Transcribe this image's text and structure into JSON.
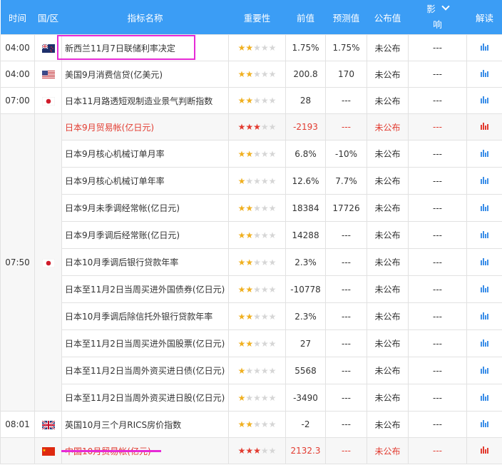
{
  "header": {
    "time": "时间",
    "country": "国/区",
    "indicator": "指标名称",
    "importance": "重要性",
    "previous": "前值",
    "forecast": "预测值",
    "actual": "公布值",
    "impact_top": "影",
    "impact_bottom": "响",
    "read": "解读"
  },
  "colors": {
    "header_bg": "#3b9df5",
    "highlight_red": "#e23b30",
    "annotation": "#e62ad6",
    "star": "#f0b020"
  },
  "rows": [
    {
      "time": "04:00",
      "flag": "nz",
      "indicator": "新西兰11月7日联储利率决定",
      "stars": 2,
      "previous": "1.75%",
      "forecast": "1.75%",
      "actual": "未公布",
      "impact": "---",
      "hi": false
    },
    {
      "time": "04:00",
      "flag": "us",
      "indicator": "美国9月消费信贷(亿美元)",
      "stars": 2,
      "previous": "200.8",
      "forecast": "170",
      "actual": "未公布",
      "impact": "---",
      "hi": false
    },
    {
      "time": "07:00",
      "flag": "jp",
      "indicator": "日本11月路透短观制造业景气判断指数",
      "stars": 2,
      "previous": "28",
      "forecast": "---",
      "actual": "未公布",
      "impact": "---",
      "hi": false
    },
    {
      "time": "",
      "flag": "",
      "indicator": "日本9月贸易帐(亿日元)",
      "stars": 3,
      "previous": "-2193",
      "forecast": "---",
      "actual": "未公布",
      "impact": "---",
      "hi": true
    },
    {
      "time": "",
      "flag": "",
      "indicator": "日本9月核心机械订单月率",
      "stars": 2,
      "previous": "6.8%",
      "forecast": "-10%",
      "actual": "未公布",
      "impact": "---",
      "hi": false
    },
    {
      "time": "",
      "flag": "",
      "indicator": "日本9月核心机械订单年率",
      "stars": 1,
      "previous": "12.6%",
      "forecast": "7.7%",
      "actual": "未公布",
      "impact": "---",
      "hi": false
    },
    {
      "time": "",
      "flag": "",
      "indicator": "日本9月未季调经常帐(亿日元)",
      "stars": 2,
      "previous": "18384",
      "forecast": "17726",
      "actual": "未公布",
      "impact": "---",
      "hi": false
    },
    {
      "time": "",
      "flag": "",
      "indicator": "日本9月季调后经常账(亿日元)",
      "stars": 2,
      "previous": "14288",
      "forecast": "---",
      "actual": "未公布",
      "impact": "---",
      "hi": false
    },
    {
      "time": "07:50",
      "flag": "jp",
      "indicator": "日本10月季调后银行贷款年率",
      "stars": 2,
      "previous": "2.3%",
      "forecast": "---",
      "actual": "未公布",
      "impact": "---",
      "hi": false
    },
    {
      "time": "",
      "flag": "",
      "indicator": "日本至11月2日当周买进外国债券(亿日元)",
      "stars": 2,
      "previous": "-10778",
      "forecast": "---",
      "actual": "未公布",
      "impact": "---",
      "hi": false
    },
    {
      "time": "",
      "flag": "",
      "indicator": "日本10月季调后除信托外银行贷款年率",
      "stars": 2,
      "previous": "2.3%",
      "forecast": "---",
      "actual": "未公布",
      "impact": "---",
      "hi": false
    },
    {
      "time": "",
      "flag": "",
      "indicator": "日本至11月2日当周买进外国股票(亿日元)",
      "stars": 2,
      "previous": "27",
      "forecast": "---",
      "actual": "未公布",
      "impact": "---",
      "hi": false
    },
    {
      "time": "",
      "flag": "",
      "indicator": "日本至11月2日当周外资买进日债(亿日元)",
      "stars": 1,
      "previous": "5568",
      "forecast": "---",
      "actual": "未公布",
      "impact": "---",
      "hi": false
    },
    {
      "time": "",
      "flag": "",
      "indicator": "日本至11月2日当周外资买进日股(亿日元)",
      "stars": 1,
      "previous": "-3490",
      "forecast": "---",
      "actual": "未公布",
      "impact": "---",
      "hi": false
    },
    {
      "time": "08:01",
      "flag": "gb",
      "indicator": "英国10月三个月RICS房价指数",
      "stars": 2,
      "previous": "-2",
      "forecast": "---",
      "actual": "未公布",
      "impact": "---",
      "hi": false
    },
    {
      "time": "",
      "flag": "cn",
      "indicator": "中国10月贸易帐(亿元)",
      "stars": 3,
      "previous": "2132.3",
      "forecast": "---",
      "actual": "未公布",
      "impact": "---",
      "hi": true
    }
  ]
}
